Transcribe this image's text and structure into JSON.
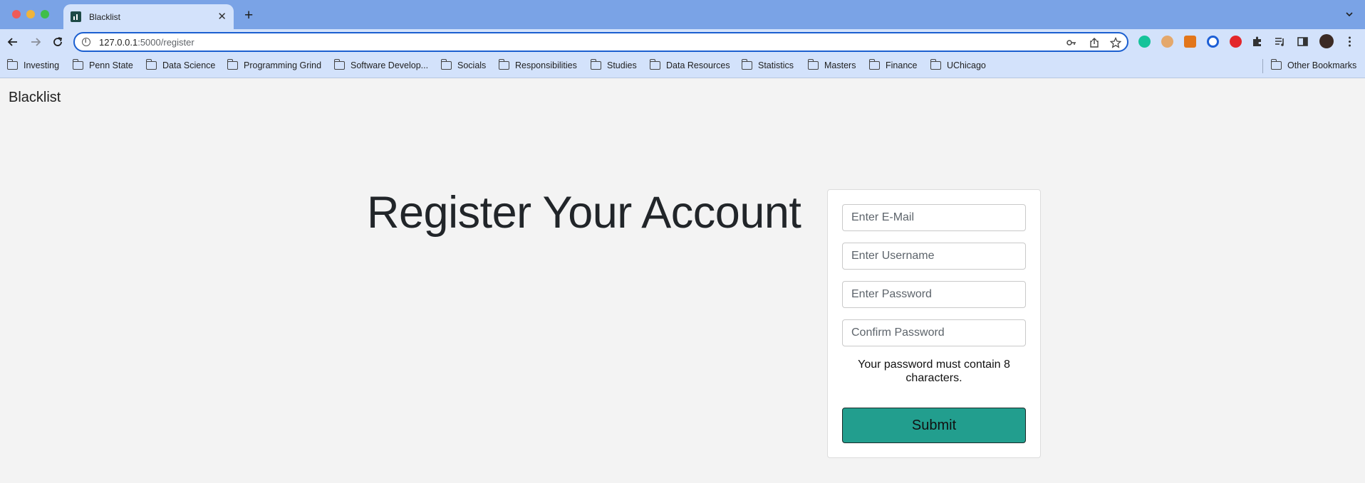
{
  "browser": {
    "tab_title": "Blacklist",
    "url_host": "127.0.0.1",
    "url_rest": ":5000/register",
    "bookmarks": [
      "Investing",
      "Penn State",
      "Data Science",
      "Programming Grind",
      "Software Develop...",
      "Socials",
      "Responsibilities",
      "Studies",
      "Data Resources",
      "Statistics",
      "Masters",
      "Finance",
      "UChicago"
    ],
    "other_bookmarks": "Other Bookmarks"
  },
  "page": {
    "brand": "Blacklist",
    "heading": "Register Your Account",
    "form": {
      "email_placeholder": "Enter E-Mail",
      "username_placeholder": "Enter Username",
      "password_placeholder": "Enter Password",
      "confirm_placeholder": "Confirm Password",
      "hint": "Your password must contain 8 characters.",
      "submit_label": "Submit"
    }
  },
  "colors": {
    "chrome": "#7aa3e6",
    "toolbar": "#d3e2fb",
    "accent": "#229e8e",
    "page_bg": "#f3f3f3"
  }
}
